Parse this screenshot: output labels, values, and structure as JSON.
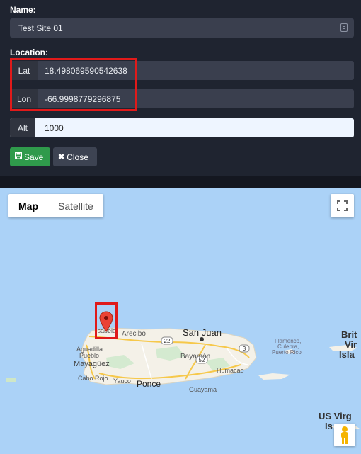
{
  "form": {
    "name_label": "Name:",
    "name_value": "Test Site 01",
    "location_label": "Location:",
    "lat_label": "Lat",
    "lat_value": "18.498069590542638",
    "lon_label": "Lon",
    "lon_value": "-66.9998779296875",
    "alt_label": "Alt",
    "alt_value": "1000",
    "save_label": "Save",
    "close_label": "Close"
  },
  "map": {
    "map_type_options": [
      "Map",
      "Satellite"
    ],
    "selected_map_type": "Map",
    "labels": {
      "isabela": "Isabela",
      "arecibo": "Arecibo",
      "san_juan": "San Juan",
      "bayamon": "Bayamón",
      "aguadilla": "Aguadilla",
      "pueblo": "Pueblo",
      "mayaguez": "Mayagüez",
      "cabo_rojo": "Cabo Rojo",
      "yauco": "Yauco",
      "ponce": "Ponce",
      "guayama": "Guayama",
      "humacao": "Humacao",
      "flamenco": "Flamenco,",
      "culebra": "Culebra,",
      "puerto_rico": "Puerto Rico",
      "brit_1": "Brit",
      "brit_2": "Vir",
      "brit_3": "Isla",
      "us_virg_1": "US Virg",
      "us_virg_2": "Is",
      "route_22": "22",
      "route_3": "3",
      "route_52": "52"
    }
  },
  "colors": {
    "panel_bg": "#1f2430",
    "field_bg": "#3a3f4e",
    "save_green": "#2f9a4b",
    "highlight_red": "#e01a1a",
    "water": "#abd2f7",
    "land": "#f4f1e8",
    "road": "#f6c84a"
  }
}
